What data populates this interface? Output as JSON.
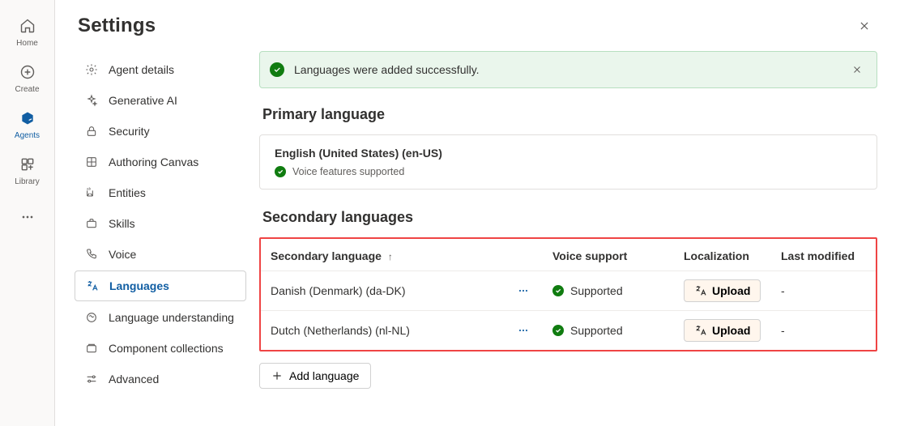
{
  "rail": {
    "items": [
      {
        "label": "Home"
      },
      {
        "label": "Create"
      },
      {
        "label": "Agents"
      },
      {
        "label": "Library"
      }
    ]
  },
  "page": {
    "title": "Settings"
  },
  "side": {
    "items": [
      {
        "label": "Agent details"
      },
      {
        "label": "Generative AI"
      },
      {
        "label": "Security"
      },
      {
        "label": "Authoring Canvas"
      },
      {
        "label": "Entities"
      },
      {
        "label": "Skills"
      },
      {
        "label": "Voice"
      },
      {
        "label": "Languages"
      },
      {
        "label": "Language understanding"
      },
      {
        "label": "Component collections"
      },
      {
        "label": "Advanced"
      }
    ]
  },
  "alert": {
    "text": "Languages were added successfully."
  },
  "primary": {
    "heading": "Primary language",
    "name": "English (United States) (en-US)",
    "voice_status": "Voice features supported"
  },
  "secondary": {
    "heading": "Secondary languages",
    "columns": {
      "lang": "Secondary language",
      "voice": "Voice support",
      "loc": "Localization",
      "modified": "Last modified"
    },
    "supported_label": "Supported",
    "upload_label": "Upload",
    "rows": [
      {
        "name": "Danish (Denmark) (da-DK)",
        "modified": "-"
      },
      {
        "name": "Dutch (Netherlands) (nl-NL)",
        "modified": "-"
      }
    ],
    "add_label": "Add language"
  }
}
